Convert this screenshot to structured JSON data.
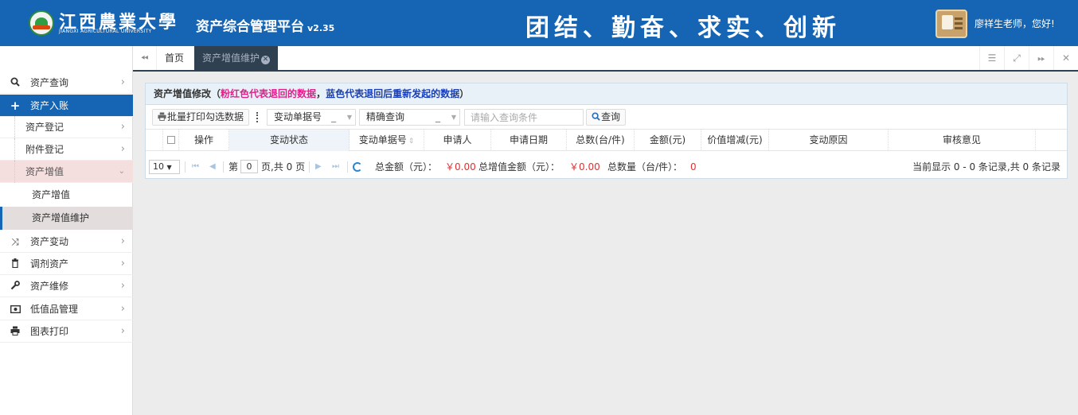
{
  "header": {
    "university_cn": "江西農業大學",
    "university_en": "JIANGXI AGRICULTURAL UNIVERSITY",
    "platform_title": "资产综合管理平台",
    "version": "v2.35",
    "motto": "团结、勤奋、求实、创新",
    "greeting": "廖祥生老师，您好!"
  },
  "sidebar": {
    "items": [
      {
        "label": "资产查询",
        "icon": "search-icon"
      },
      {
        "label": "资产入账",
        "icon": "plus-icon"
      },
      {
        "label": "资产登记"
      },
      {
        "label": "附件登记"
      },
      {
        "label": "资产增值"
      },
      {
        "label": "资产增值"
      },
      {
        "label": "资产增值维护"
      },
      {
        "label": "资产变动",
        "icon": "shuffle-icon"
      },
      {
        "label": "调剂资产",
        "icon": "trash-icon"
      },
      {
        "label": "资产维修",
        "icon": "wrench-icon"
      },
      {
        "label": "低值品管理",
        "icon": "money-icon"
      },
      {
        "label": "图表打印",
        "icon": "print-icon"
      }
    ]
  },
  "tabs": {
    "home": "首页",
    "current": "资产增值维护"
  },
  "panel": {
    "title": "资产增值修改",
    "paren_open": "（",
    "note_pink": "粉红色代表退回的数据",
    "comma": "，",
    "note_blue": "蓝色代表退回后重新发起的数据",
    "paren_close": "）"
  },
  "toolbar": {
    "print_label": "批量打印勾选数据",
    "field_select": "变动单据号",
    "mode_select": "精确查询",
    "underscore": "_",
    "search_placeholder": "请输入查询条件",
    "query_label": "查询"
  },
  "table": {
    "columns": [
      "操作",
      "变动状态",
      "变动单据号",
      "申请人",
      "申请日期",
      "总数(台/件)",
      "金额(元)",
      "价值增减(元)",
      "变动原因",
      "审核意见"
    ]
  },
  "pager": {
    "page_size": "10",
    "page_prefix": "第",
    "page_value": "0",
    "page_suffix": "页,共 0 页",
    "total_amount_label": "总金额（元）：",
    "total_amount": "￥0.00",
    "total_increment_label": "总增值金额（元）：",
    "total_increment": "￥0.00",
    "total_qty_label": "总数量（台/件）：",
    "total_qty": "0",
    "records": "当前显示 0 - 0 条记录,共 0 条记录"
  },
  "colors": {
    "header_blue": "#1565b4",
    "tab_dark": "#2f4050",
    "note_pink": "#e0218a",
    "note_blue": "#1a3fb5",
    "amount_red": "#e03131"
  }
}
